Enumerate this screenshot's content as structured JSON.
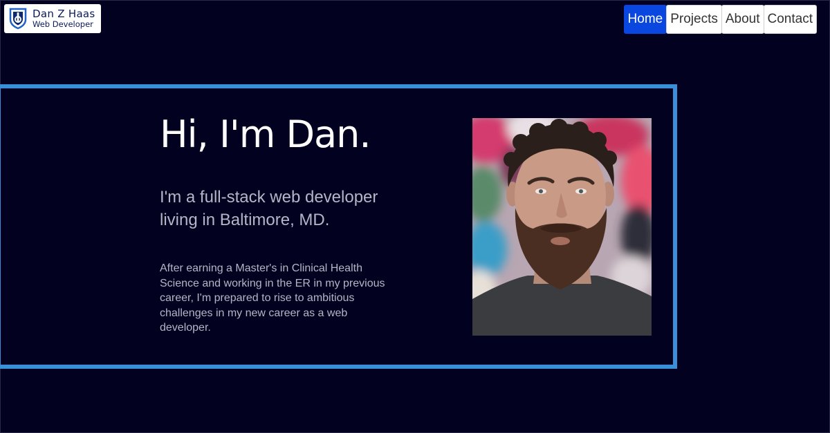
{
  "logo": {
    "name": "Dan Z Haas",
    "subtitle": "Web Developer",
    "icon": "shield-d-logo-icon"
  },
  "nav": {
    "items": [
      {
        "label": "Home",
        "active": true
      },
      {
        "label": "Projects",
        "active": false
      },
      {
        "label": "About",
        "active": false
      },
      {
        "label": "Contact",
        "active": false
      }
    ]
  },
  "hero": {
    "title": "Hi, I'm Dan.",
    "subtitle": "I'm a full-stack web developer living in Baltimore, MD.",
    "body": "After earning a Master's in Clinical Health Science and working in the ER in my previous career, I'm prepared to rise to ambitious challenges in my new career as a web developer.",
    "photo": "portrait-photo"
  },
  "colors": {
    "background": "#020220",
    "frame": "#3a8fd8",
    "nav_active": "#0a47e0",
    "text_muted": "#b3b6c6"
  }
}
